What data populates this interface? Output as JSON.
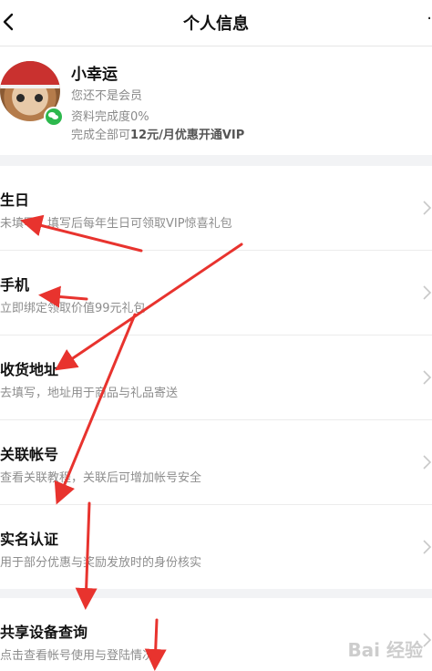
{
  "header": {
    "title": "个人信息",
    "more_icon": "more-dots-icon",
    "back_icon": "chevron-left-icon"
  },
  "profile": {
    "nickname": "小幸运",
    "member_status": "您还不是会员",
    "completion": "资料完成度0%",
    "vip_prefix": "完成全部可",
    "vip_offer": "12元/月优惠开通VIP"
  },
  "items": [
    {
      "title": "生日",
      "desc": "未填写，填写后每年生日可领取VIP惊喜礼包"
    },
    {
      "title": "手机",
      "desc": "立即绑定领取价值99元礼包"
    },
    {
      "title": "收货地址",
      "desc": "去填写，地址用于商品与礼品寄送"
    },
    {
      "title": "关联帐号",
      "desc": "查看关联教程，关联后可增加帐号安全"
    },
    {
      "title": "实名认证",
      "desc": "用于部分优惠与奖励发放时的身份核实"
    },
    {
      "title": "共享设备查询",
      "desc": "点击查看帐号使用与登陆情况"
    }
  ],
  "watermark": "Bai 经验",
  "colors": {
    "annotation_red": "#e8332e",
    "divider_gray": "#f2f3f5",
    "wechat_green": "#2db84d"
  }
}
